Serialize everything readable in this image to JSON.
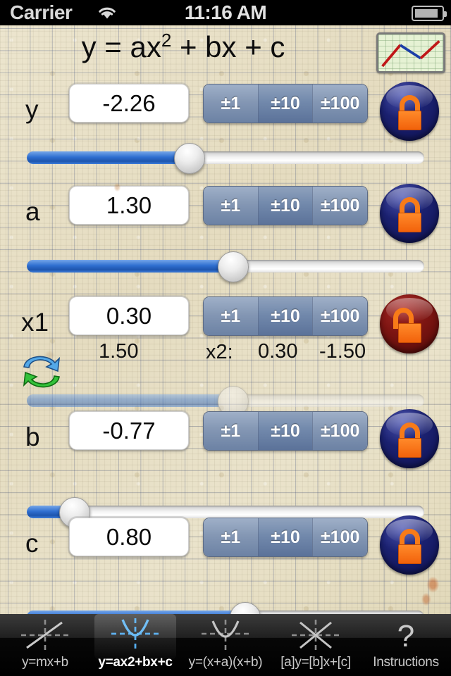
{
  "status_bar": {
    "carrier": "Carrier",
    "time": "11:16 AM",
    "wifi_icon": "wifi-icon",
    "battery_icon": "battery-icon"
  },
  "header": {
    "equation_prefix": "y = ax",
    "equation_exponent": "2",
    "equation_suffix": " + bx + c",
    "graph_thumb_icon": "graph-preview-icon"
  },
  "segmented_labels": [
    "±1",
    "±10",
    "±100"
  ],
  "rows": [
    {
      "label": "y",
      "value": "-2.26",
      "lock_state": "locked",
      "lock_icon": "lock-closed-icon",
      "slider_percent": 41,
      "slider_disabled": false
    },
    {
      "label": "a",
      "value": "1.30",
      "lock_state": "locked",
      "lock_icon": "lock-closed-icon",
      "slider_percent": 52,
      "slider_disabled": false
    },
    {
      "label": "x1",
      "value": "0.30",
      "secondary_value": "1.50",
      "x2_label": "x2:",
      "x2_value_a": "0.30",
      "x2_value_b": "-1.50",
      "swap_icon": "swap-roots-icon",
      "lock_state": "unlocked",
      "lock_icon": "lock-open-icon",
      "slider_percent": 52,
      "slider_disabled": true
    },
    {
      "label": "b",
      "value": "-0.77",
      "lock_state": "locked",
      "lock_icon": "lock-closed-icon",
      "slider_percent": 12,
      "slider_disabled": false
    },
    {
      "label": "c",
      "value": "0.80",
      "lock_state": "locked",
      "lock_icon": "lock-closed-icon",
      "slider_percent": 55,
      "slider_disabled": false
    }
  ],
  "tabs": [
    {
      "label": "y=mx+b",
      "icon": "line-graph-icon",
      "active": false
    },
    {
      "label": "y=ax2+bx+c",
      "icon": "parabola-graph-icon",
      "active": true
    },
    {
      "label": "y=(x+a)(x+b)",
      "icon": "factored-parabola-icon",
      "active": false
    },
    {
      "label": "[a]y=[b]x+[c]",
      "icon": "asterisk-lines-icon",
      "active": false
    },
    {
      "label": "Instructions",
      "icon": "question-mark-icon",
      "active": false
    }
  ],
  "colors": {
    "paper": "#e9e1c9",
    "grid": "#3a4a78",
    "lock_locked": "#1b2170",
    "lock_unlocked": "#7d1512",
    "lock_body": "#f8731a",
    "slider_fill": "#2f6fd0",
    "segment": "#8497b4",
    "tab_active_text": "#ffffff"
  }
}
